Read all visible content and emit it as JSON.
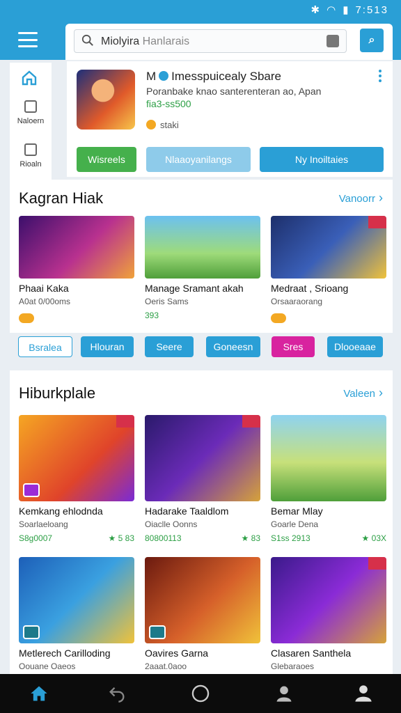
{
  "status_bar": {
    "time": "7:513"
  },
  "search": {
    "query": "Miolyira",
    "placeholder": "Hanlarais"
  },
  "side_nav": {
    "items": [
      {
        "label": "Naloern"
      },
      {
        "label": "Rioaln"
      }
    ]
  },
  "featured": {
    "app_initial": "M",
    "title": "Imesspuicealy Sbare",
    "description": "Poranbake knao santerenteran ao, Apan",
    "price": "fia3-ss500",
    "rating": "staki",
    "buttons": [
      {
        "label": "Wisreels"
      },
      {
        "label": "Nlaaoyanilangs"
      },
      {
        "label": "Ny Inoiltaies"
      }
    ]
  },
  "section1": {
    "title": "Kagran Hiak",
    "see_all": "Vanoorr",
    "cards": [
      {
        "title": "Phaai Kaka",
        "subtitle": "A0at 0/00oms",
        "meta": ""
      },
      {
        "title": "Manage Sramant akah",
        "subtitle": "Oeris Sams",
        "meta": "393"
      },
      {
        "title": "Medraat , Srioang",
        "subtitle": "Orsaaraorang",
        "meta": ""
      }
    ]
  },
  "chips": [
    {
      "label": "Bsralea"
    },
    {
      "label": "Hlouran"
    },
    {
      "label": "Seere"
    },
    {
      "label": "Goneesn"
    },
    {
      "label": "Sres"
    },
    {
      "label": "Dlooeaae"
    }
  ],
  "section2": {
    "title": "Hiburkplale",
    "see_all": "Valeen",
    "cards": [
      {
        "title": "Kemkang ehlodnda",
        "subtitle": "Soarlaeloang",
        "price": "S8g0007",
        "rating": "★ 5 83"
      },
      {
        "title": "Hadarake Taaldlom",
        "subtitle": "Oiaclle Oonns",
        "price": "80800113",
        "rating": "★ 83"
      },
      {
        "title": "Bemar Mlay",
        "subtitle": "Goarle Dena",
        "price": "S1ss 2913",
        "rating": "★ 03X"
      },
      {
        "title": "Metlerech Carilloding",
        "subtitle": "Oouane Oaeos",
        "price": "",
        "rating": ""
      },
      {
        "title": "Oavires Garna",
        "subtitle": "2aaat.0aoo",
        "price": "",
        "rating": ""
      },
      {
        "title": "Clasaren Santhela",
        "subtitle": "Glebaraoes",
        "price": "",
        "rating": ""
      }
    ]
  },
  "colors": {
    "primary": "#2a9fd6",
    "green": "#45b04c",
    "light_blue": "#8ecbea",
    "magenta": "#d8239f"
  },
  "icons": [
    "wifi-icon",
    "battery-icon",
    "menu-icon",
    "search-icon",
    "mic-icon",
    "home-icon",
    "back-icon",
    "circle-home-icon",
    "profile-icon"
  ]
}
